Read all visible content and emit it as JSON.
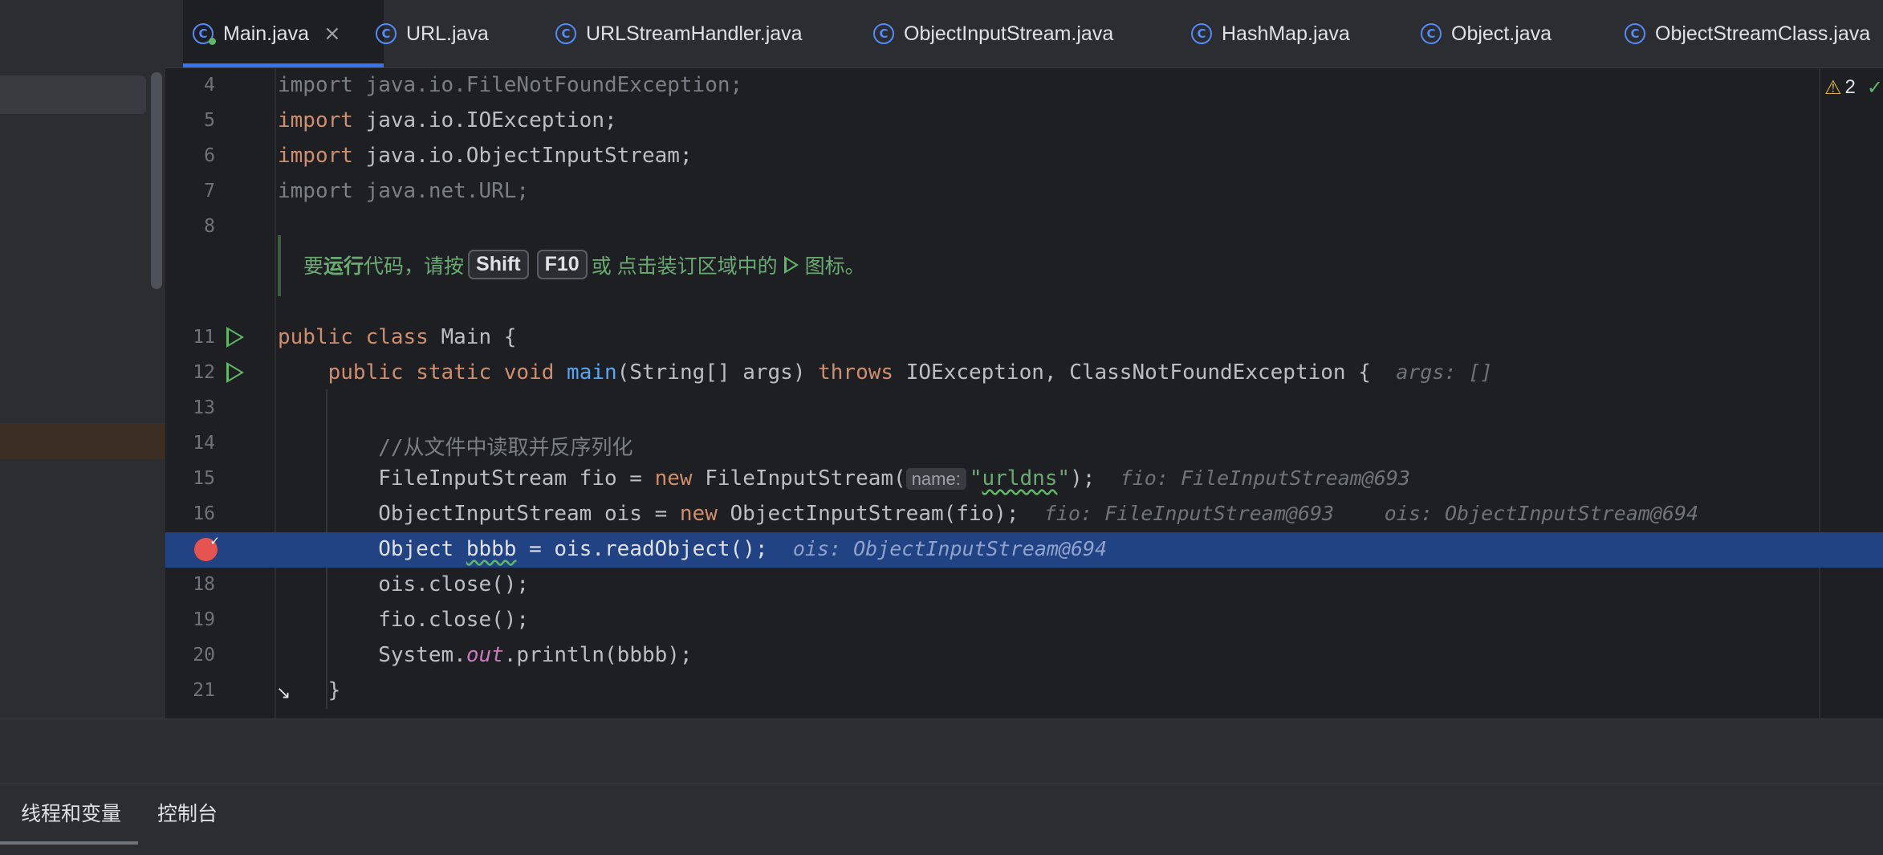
{
  "tabs": [
    {
      "label": "Main.java",
      "active": true,
      "icon": "class-icon-running"
    },
    {
      "label": "URL.java",
      "icon": "class-icon"
    },
    {
      "label": "URLStreamHandler.java",
      "icon": "class-icon"
    },
    {
      "label": "ObjectInputStream.java",
      "icon": "class-icon"
    },
    {
      "label": "HashMap.java",
      "icon": "class-icon"
    },
    {
      "label": "Object.java",
      "icon": "class-icon"
    },
    {
      "label": "ObjectStreamClass.java",
      "icon": "class-icon"
    }
  ],
  "close_symbol": "×",
  "editor": {
    "warnings_count": "2",
    "line_numbers": {
      "l4": "4",
      "l5": "5",
      "l6": "6",
      "l7": "7",
      "l8": "8",
      "l11": "11",
      "l12": "12",
      "l13": "13",
      "l14": "14",
      "l15": "15",
      "l16": "16",
      "l18": "18",
      "l19": "19",
      "l20": "20",
      "l21": "21"
    },
    "inlay_hint": {
      "prefix": "要",
      "run_word": "运行",
      "middle": "代码，请按",
      "key1": "Shift",
      "key2": "F10",
      "or": "或 点击装订区域中的",
      "suffix": "图标。"
    },
    "hints": {
      "args": "args: []",
      "param_name": "name:",
      "fio_l15": "fio: FileInputStream@693",
      "fio_l16": "fio: FileInputStream@693",
      "ois_l16": "ois: ObjectInputStream@694",
      "ois_l17": "ois: ObjectInputStream@694"
    },
    "comment": "//从文件中读取并反序列化"
  },
  "bottom_panel": {
    "tab_threads": "线程和变量",
    "tab_console": "控制台"
  }
}
